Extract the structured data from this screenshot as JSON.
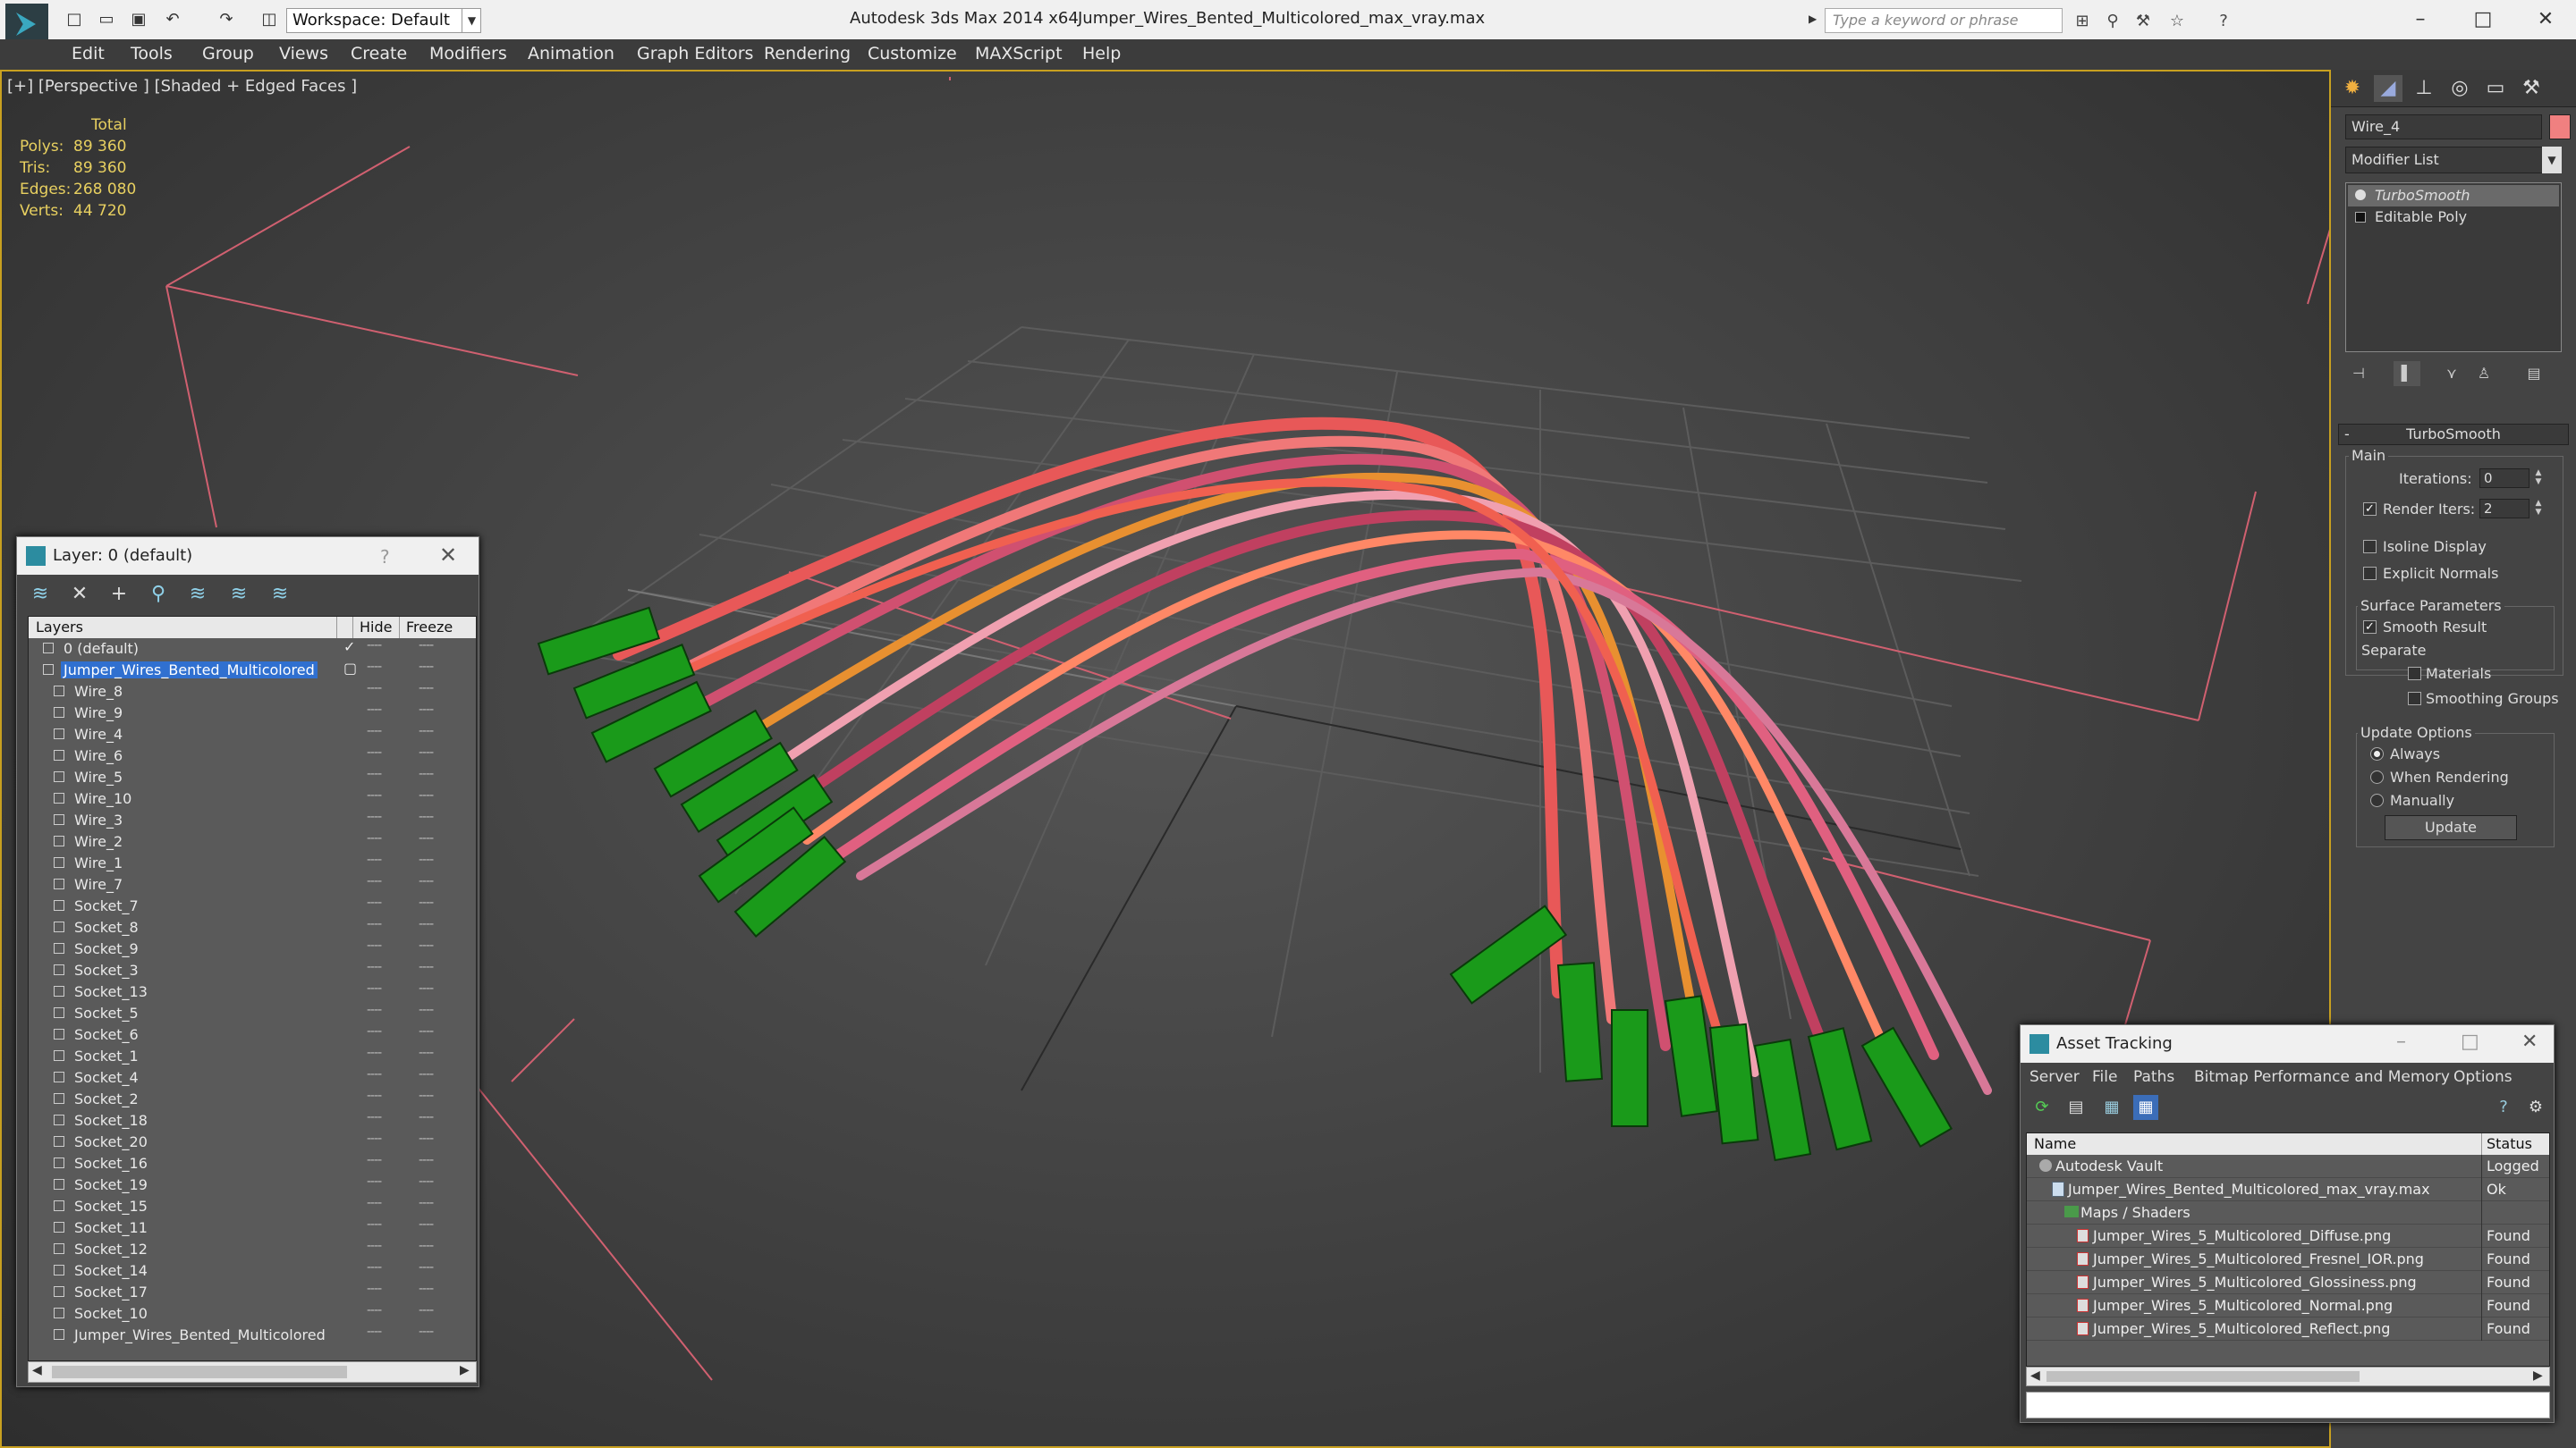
{
  "titlebar": {
    "workspace": "Workspace: Default",
    "app_title": "Autodesk 3ds Max  2014 x64",
    "file_title": "Jumper_Wires_Bented_Multicolored_max_vray.max",
    "search_placeholder": "Type a keyword or phrase"
  },
  "menu": [
    "Edit",
    "Tools",
    "Group",
    "Views",
    "Create",
    "Modifiers",
    "Animation",
    "Graph Editors",
    "Rendering",
    "Customize",
    "MAXScript",
    "Help"
  ],
  "viewport": {
    "label": "[+] [Perspective ] [Shaded + Edged Faces ]",
    "stats_header": "Total",
    "stats": [
      {
        "name": "Polys:",
        "value": "89 360"
      },
      {
        "name": "Tris:",
        "value": "89 360"
      },
      {
        "name": "Edges:",
        "value": "268 080"
      },
      {
        "name": "Verts:",
        "value": "44 720"
      }
    ]
  },
  "layer_dialog": {
    "title": "Layer: 0 (default)",
    "help": "?",
    "columns": {
      "layers": "Layers",
      "hide": "Hide",
      "freeze": "Freeze"
    },
    "rows": [
      {
        "label": "0 (default)",
        "level": 0,
        "checked": true
      },
      {
        "label": "Jumper_Wires_Bented_Multicolored",
        "level": 0,
        "selected": true
      },
      {
        "label": "Wire_8",
        "level": 1
      },
      {
        "label": "Wire_9",
        "level": 1
      },
      {
        "label": "Wire_4",
        "level": 1
      },
      {
        "label": "Wire_6",
        "level": 1
      },
      {
        "label": "Wire_5",
        "level": 1
      },
      {
        "label": "Wire_10",
        "level": 1
      },
      {
        "label": "Wire_3",
        "level": 1
      },
      {
        "label": "Wire_2",
        "level": 1
      },
      {
        "label": "Wire_1",
        "level": 1
      },
      {
        "label": "Wire_7",
        "level": 1
      },
      {
        "label": "Socket_7",
        "level": 1
      },
      {
        "label": "Socket_8",
        "level": 1
      },
      {
        "label": "Socket_9",
        "level": 1
      },
      {
        "label": "Socket_3",
        "level": 1
      },
      {
        "label": "Socket_13",
        "level": 1
      },
      {
        "label": "Socket_5",
        "level": 1
      },
      {
        "label": "Socket_6",
        "level": 1
      },
      {
        "label": "Socket_1",
        "level": 1
      },
      {
        "label": "Socket_4",
        "level": 1
      },
      {
        "label": "Socket_2",
        "level": 1
      },
      {
        "label": "Socket_18",
        "level": 1
      },
      {
        "label": "Socket_20",
        "level": 1
      },
      {
        "label": "Socket_16",
        "level": 1
      },
      {
        "label": "Socket_19",
        "level": 1
      },
      {
        "label": "Socket_15",
        "level": 1
      },
      {
        "label": "Socket_11",
        "level": 1
      },
      {
        "label": "Socket_12",
        "level": 1
      },
      {
        "label": "Socket_14",
        "level": 1
      },
      {
        "label": "Socket_17",
        "level": 1
      },
      {
        "label": "Socket_10",
        "level": 1
      },
      {
        "label": "Jumper_Wires_Bented_Multicolored",
        "level": 1
      }
    ]
  },
  "command_panel": {
    "object_name": "Wire_4",
    "object_color": "#f08080",
    "modifier_list": "Modifier List",
    "stack": [
      {
        "label": "TurboSmooth",
        "active": true
      },
      {
        "label": "Editable Poly",
        "active": false
      }
    ],
    "rollout_title": "TurboSmooth",
    "main_group": "Main",
    "iterations_label": "Iterations:",
    "iterations_value": "0",
    "render_iters_label": "Render Iters:",
    "render_iters_value": "2",
    "isoline_label": "Isoline Display",
    "explicit_normals_label": "Explicit Normals",
    "surface_group": "Surface Parameters",
    "smooth_result_label": "Smooth Result",
    "separate_label": "Separate",
    "materials_label": "Materials",
    "smoothing_groups_label": "Smoothing Groups",
    "update_group": "Update Options",
    "always_label": "Always",
    "when_rendering_label": "When Rendering",
    "manually_label": "Manually",
    "update_button": "Update"
  },
  "asset_tracking": {
    "title": "Asset Tracking",
    "menus": [
      "Server",
      "File",
      "Paths",
      "Bitmap Performance and Memory",
      "Options"
    ],
    "columns": {
      "name": "Name",
      "status": "Status"
    },
    "rows": [
      {
        "name": "Autodesk Vault",
        "status": "Logged",
        "level": 0,
        "icon": "vault"
      },
      {
        "name": "Jumper_Wires_Bented_Multicolored_max_vray.max",
        "status": "Ok",
        "level": 1,
        "icon": "max"
      },
      {
        "name": "Maps / Shaders",
        "status": "",
        "level": 2,
        "icon": "folder"
      },
      {
        "name": "Jumper_Wires_5_Multicolored_Diffuse.png",
        "status": "Found",
        "level": 3,
        "icon": "png"
      },
      {
        "name": "Jumper_Wires_5_Multicolored_Fresnel_IOR.png",
        "status": "Found",
        "level": 3,
        "icon": "png"
      },
      {
        "name": "Jumper_Wires_5_Multicolored_Glossiness.png",
        "status": "Found",
        "level": 3,
        "icon": "png"
      },
      {
        "name": "Jumper_Wires_5_Multicolored_Normal.png",
        "status": "Found",
        "level": 3,
        "icon": "png"
      },
      {
        "name": "Jumper_Wires_5_Multicolored_Reflect.png",
        "status": "Found",
        "level": 3,
        "icon": "png"
      }
    ]
  },
  "colors": {
    "accent_selection": "#3070d0",
    "viewport_border": "#c8a020",
    "stats_text": "#e8d060",
    "socket_green": "#1a9a1a",
    "wire_colors": [
      "#e85858",
      "#f07878",
      "#d05070",
      "#e89030",
      "#f0a0b0",
      "#c04060",
      "#ff8866",
      "#e06080",
      "#d87898",
      "#f06050"
    ]
  }
}
